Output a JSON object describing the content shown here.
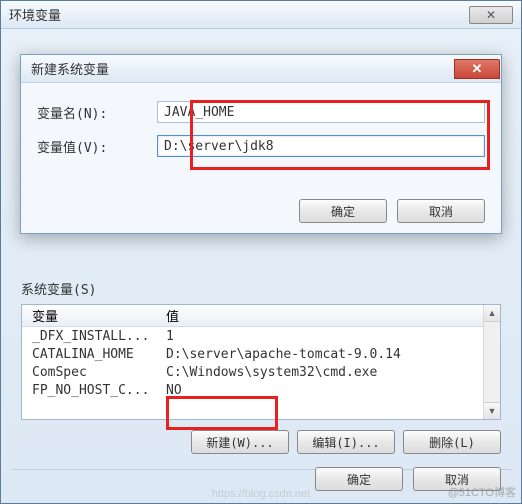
{
  "outer": {
    "title": "环境变量",
    "close_glyph": "✕"
  },
  "inner": {
    "title": "新建系统变量",
    "close_glyph": "✕",
    "name_label": "变量名(N):",
    "value_label": "变量值(V):",
    "name_value": "JAVA_HOME",
    "value_value": "D:\\server\\jdk8",
    "ok": "确定",
    "cancel": "取消"
  },
  "sysvars": {
    "label": "系统变量(S)",
    "col_var": "变量",
    "col_val": "值",
    "rows": [
      {
        "var": "_DFX_INSTALL...",
        "val": "1"
      },
      {
        "var": "CATALINA_HOME",
        "val": "D:\\server\\apache-tomcat-9.0.14"
      },
      {
        "var": "ComSpec",
        "val": "C:\\Windows\\system32\\cmd.exe"
      },
      {
        "var": "FP_NO_HOST_C...",
        "val": "NO"
      }
    ],
    "new_btn": "新建(W)...",
    "edit_btn": "编辑(I)...",
    "delete_btn": "删除(L)"
  },
  "bottom": {
    "ok": "确定",
    "cancel": "取消"
  },
  "watermark": "@51CTO博客",
  "watermark2": "https://blog.csdn.net"
}
